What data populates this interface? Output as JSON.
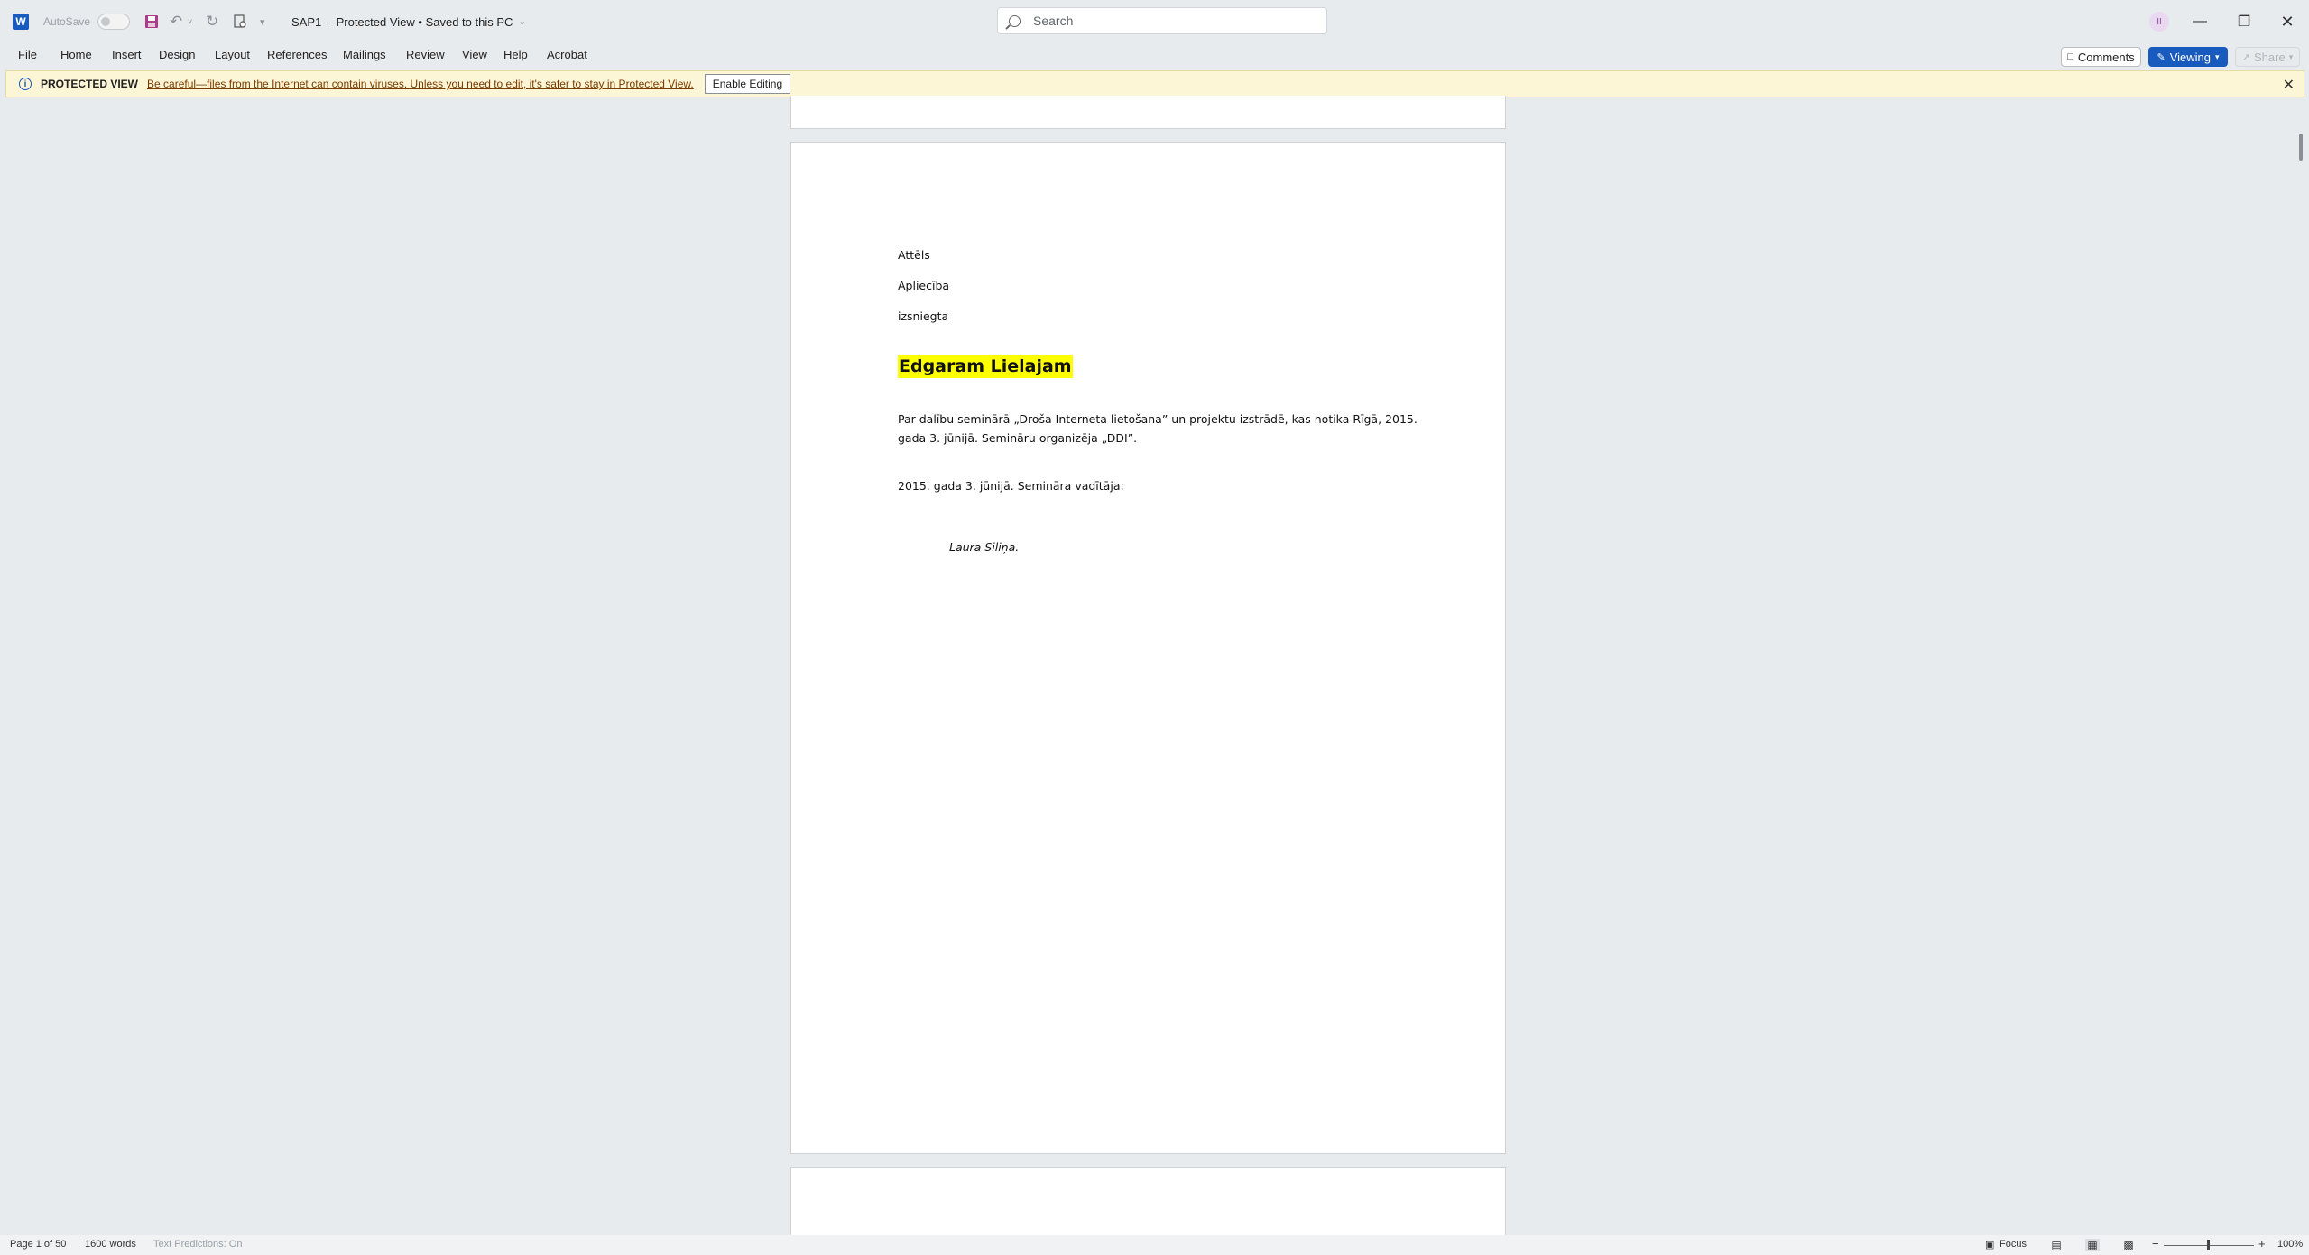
{
  "titlebar": {
    "app_icon": "word-icon",
    "autosave_label": "AutoSave",
    "autosave_state": "Off",
    "doc_title": "SAP1",
    "doc_status": "Protected View • Saved to this PC",
    "search_placeholder": "Search",
    "avatar_initial": "II"
  },
  "menu": {
    "items": [
      "File",
      "Home",
      "Insert",
      "Design",
      "Layout",
      "References",
      "Mailings",
      "Review",
      "View",
      "Help",
      "Acrobat"
    ],
    "comments_label": "Comments",
    "viewing_label": "Viewing",
    "share_label": "Share"
  },
  "protected_view": {
    "title": "PROTECTED VIEW",
    "message": "Be careful—files from the Internet can contain viruses. Unless you need to edit, it's safer to stay in Protected View.",
    "button": "Enable Editing"
  },
  "document": {
    "line1": "Attēls",
    "line2": "Apliecība",
    "line3": "izsniegta",
    "heading": "Edgaram Lielajam",
    "para1_line1": "Par dalību seminārā „Droša Interneta lietošana” un projektu izstrādē, kas notika Rīgā, 2015.",
    "para1_line2": "gada 3. jūnijā. Semināru organizēja „DDI”.",
    "para2": "2015. gada 3. jūnijā. Semināra vadītāja:",
    "signature": "Laura Siliņa."
  },
  "status": {
    "page": "Page 1 of 50",
    "words": "1600 words",
    "predictions": "Text Predictions: On",
    "focus": "Focus",
    "zoom": "100%"
  }
}
